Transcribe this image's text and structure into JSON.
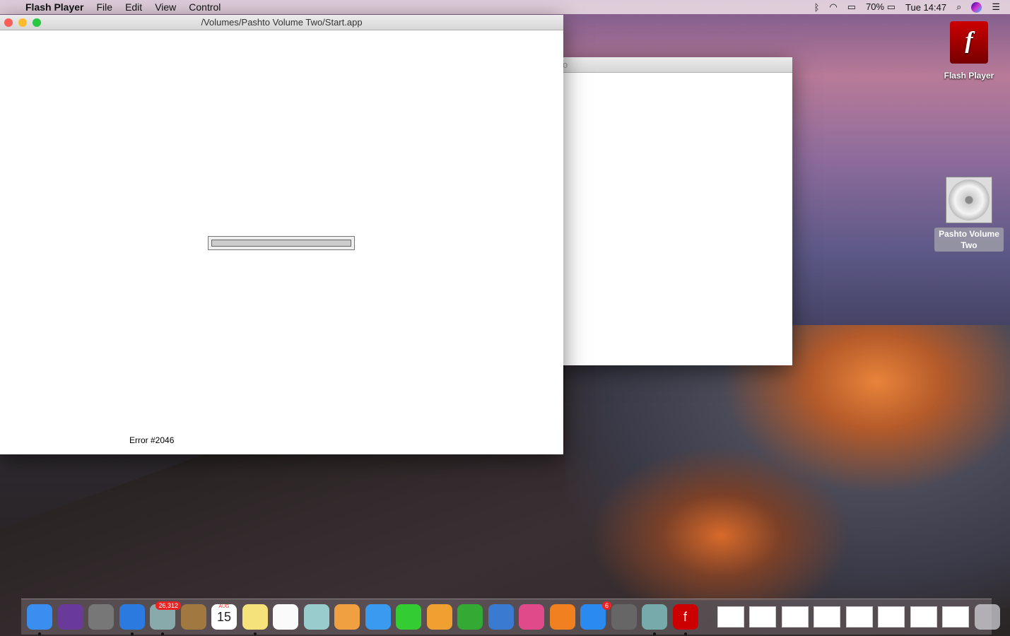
{
  "menubar": {
    "app": "Flash Player",
    "items": [
      "File",
      "Edit",
      "View",
      "Control"
    ],
    "battery": "70%",
    "clock": "Tue 14:47"
  },
  "main_window": {
    "title": "/Volumes/Pashto Volume Two/Start.app",
    "progress": 0,
    "error": "Error #2046"
  },
  "back_window": {
    "title": "o"
  },
  "desktop": {
    "icons": [
      {
        "label": "Flash Player"
      },
      {
        "label": "Pashto Volume Two"
      }
    ]
  },
  "dock": {
    "apps": [
      {
        "name": "Finder",
        "color": "#3a8ef0",
        "running": true
      },
      {
        "name": "Siri",
        "color": "#6a3a9a"
      },
      {
        "name": "Launchpad",
        "color": "#777"
      },
      {
        "name": "Safari",
        "color": "#2a7ae0",
        "running": true
      },
      {
        "name": "Mail",
        "color": "#8aa",
        "badge": "26,312",
        "running": true
      },
      {
        "name": "Contacts",
        "color": "#a07840"
      },
      {
        "name": "Calendar",
        "color": "#fff",
        "text": "15",
        "month": "AUG"
      },
      {
        "name": "Notes",
        "color": "#f5e27a",
        "running": true
      },
      {
        "name": "Reminders",
        "color": "#fafafa"
      },
      {
        "name": "Maps",
        "color": "#9cc"
      },
      {
        "name": "Photos",
        "color": "#f0a040"
      },
      {
        "name": "Messages",
        "color": "#3a9af0"
      },
      {
        "name": "FaceTime",
        "color": "#3c3"
      },
      {
        "name": "Pages",
        "color": "#f0a030"
      },
      {
        "name": "Numbers",
        "color": "#3a3"
      },
      {
        "name": "Keynote",
        "color": "#3a7ad0"
      },
      {
        "name": "iTunes",
        "color": "#e04a8a"
      },
      {
        "name": "iBooks",
        "color": "#f08020"
      },
      {
        "name": "App Store",
        "color": "#2a8af0",
        "badge": "6"
      },
      {
        "name": "System Preferences",
        "color": "#666"
      },
      {
        "name": "Preview",
        "color": "#7aa",
        "running": true
      },
      {
        "name": "Flash Player",
        "color": "#c00",
        "text": "f",
        "running": true
      }
    ],
    "documents": 8
  }
}
